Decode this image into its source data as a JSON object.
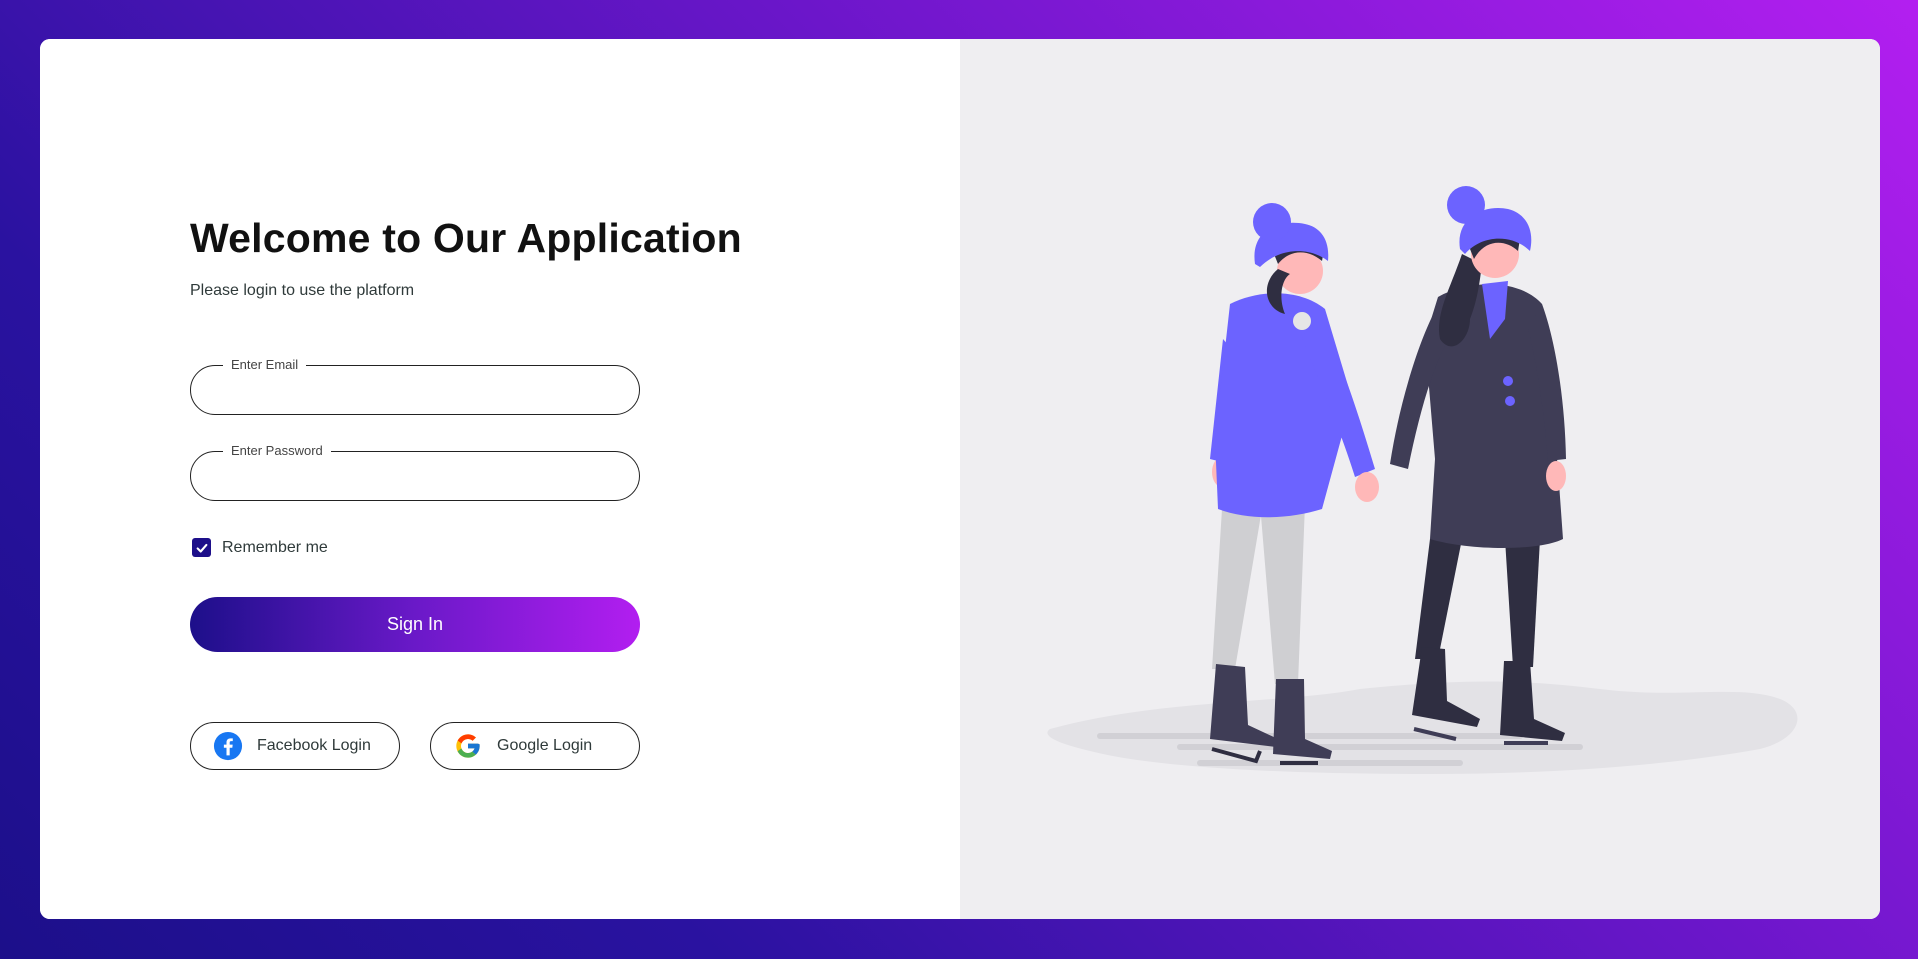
{
  "login": {
    "title": "Welcome to Our Application",
    "subtitle": "Please login to use the platform",
    "email_label": "Enter Email",
    "email_value": "",
    "password_label": "Enter Password",
    "password_value": "",
    "remember_label": "Remember me",
    "remember_checked": true,
    "signin_label": "Sign In"
  },
  "social": {
    "facebook_label": "Facebook Login",
    "google_label": "Google Login"
  },
  "illustration": {
    "icon": "ice-skating-couple-illustration"
  },
  "colors": {
    "accent_start": "#1d0f8a",
    "accent_end": "#b21ef0",
    "hat_coat": "#6c63ff",
    "dark_coat": "#3f3d56"
  }
}
